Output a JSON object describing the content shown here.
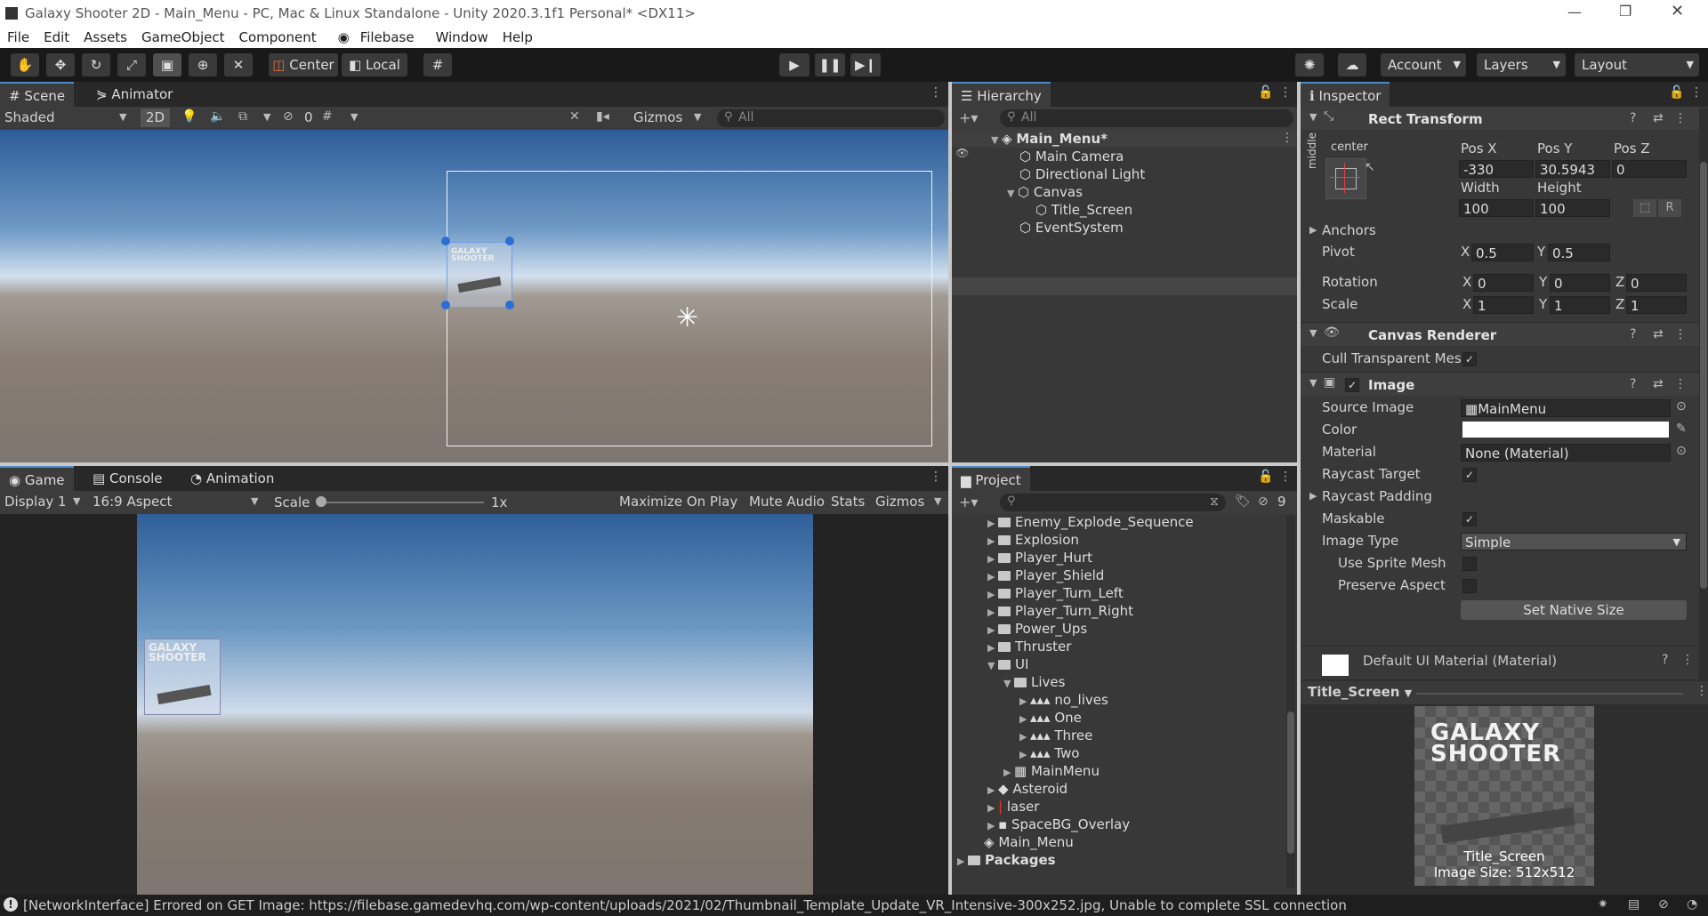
{
  "window": {
    "title": "Galaxy Shooter 2D - Main_Menu - PC, Mac & Linux Standalone - Unity 2020.3.1f1 Personal* <DX11>"
  },
  "menu": [
    "File",
    "Edit",
    "Assets",
    "GameObject",
    "Component",
    "Filebase",
    "Window",
    "Help"
  ],
  "toolbar": {
    "center": "Center",
    "local": "Local",
    "account": "Account",
    "layers": "Layers",
    "layout": "Layout"
  },
  "scene": {
    "tab_scene": "Scene",
    "tab_animator": "Animator",
    "shading": "Shaded",
    "mode_2d": "2D",
    "hidden_count": "0",
    "gizmos": "Gizmos",
    "search_placeholder": "All",
    "logo_text": "GALAXY SHOOTER"
  },
  "game": {
    "tab_game": "Game",
    "tab_console": "Console",
    "tab_animation": "Animation",
    "display": "Display 1",
    "aspect": "16:9 Aspect",
    "scale_label": "Scale",
    "scale_value": "1x",
    "maximize": "Maximize On Play",
    "mute": "Mute Audio",
    "stats": "Stats",
    "gizmos": "Gizmos",
    "logo_text": "GALAXY SHOOTER"
  },
  "hierarchy": {
    "tab": "Hierarchy",
    "search_placeholder": "All",
    "items": [
      {
        "label": "Main_Menu*"
      },
      {
        "label": "Main Camera"
      },
      {
        "label": "Directional Light"
      },
      {
        "label": "Canvas"
      },
      {
        "label": "Title_Screen"
      },
      {
        "label": "EventSystem"
      }
    ]
  },
  "project": {
    "tab": "Project",
    "hidden_count": "9",
    "items": [
      {
        "label": "Enemy_Explode_Sequence"
      },
      {
        "label": "Explosion"
      },
      {
        "label": "Player_Hurt"
      },
      {
        "label": "Player_Shield"
      },
      {
        "label": "Player_Turn_Left"
      },
      {
        "label": "Player_Turn_Right"
      },
      {
        "label": "Power_Ups"
      },
      {
        "label": "Thruster"
      },
      {
        "label": "UI"
      },
      {
        "label": "Lives"
      },
      {
        "label": "no_lives"
      },
      {
        "label": "One"
      },
      {
        "label": "Three"
      },
      {
        "label": "Two"
      },
      {
        "label": "MainMenu"
      },
      {
        "label": "Asteroid"
      },
      {
        "label": "laser"
      },
      {
        "label": "SpaceBG_Overlay"
      },
      {
        "label": "Main_Menu"
      },
      {
        "label": "Packages"
      }
    ]
  },
  "inspector": {
    "tab": "Inspector",
    "rect": {
      "title": "Rect Transform",
      "anchor_h": "center",
      "anchor_v": "middle",
      "posx_label": "Pos X",
      "posy_label": "Pos Y",
      "posz_label": "Pos Z",
      "posx": "-330",
      "posy": "30.5943",
      "posz": "0",
      "width_label": "Width",
      "height_label": "Height",
      "width": "100",
      "height": "100",
      "anchors": "Anchors",
      "pivot": "Pivot",
      "pivot_x": "0.5",
      "pivot_y": "0.5",
      "rotation": "Rotation",
      "rot_x": "0",
      "rot_y": "0",
      "rot_z": "0",
      "scale": "Scale",
      "scale_x": "1",
      "scale_y": "1",
      "scale_z": "1",
      "x": "X",
      "y": "Y",
      "z": "Z",
      "r": "R"
    },
    "canvas_renderer": {
      "title": "Canvas Renderer",
      "cull": "Cull Transparent Mes"
    },
    "image": {
      "title": "Image",
      "source_label": "Source Image",
      "source_value": "MainMenu",
      "color_label": "Color",
      "material_label": "Material",
      "material_value": "None (Material)",
      "raycast_target": "Raycast Target",
      "raycast_padding": "Raycast Padding",
      "maskable": "Maskable",
      "image_type_label": "Image Type",
      "image_type_value": "Simple",
      "use_sprite_mesh": "Use Sprite Mesh",
      "preserve_aspect": "Preserve Aspect",
      "set_native": "Set Native Size"
    },
    "default_material": "Default UI Material (Material)",
    "preview": {
      "object": "Title_Screen",
      "name": "Title_Screen",
      "size": "Image Size: 512x512",
      "logo_line1": "GALAXY",
      "logo_line2": "SHOOTER"
    }
  },
  "status": {
    "message": "[NetworkInterface] Errored on GET Image: https://filebase.gamedevhq.com/wp-content/uploads/2021/02/Thumbnail_Template_Update_VR_Intensive-300x252.jpg, Unable to complete SSL connection"
  }
}
